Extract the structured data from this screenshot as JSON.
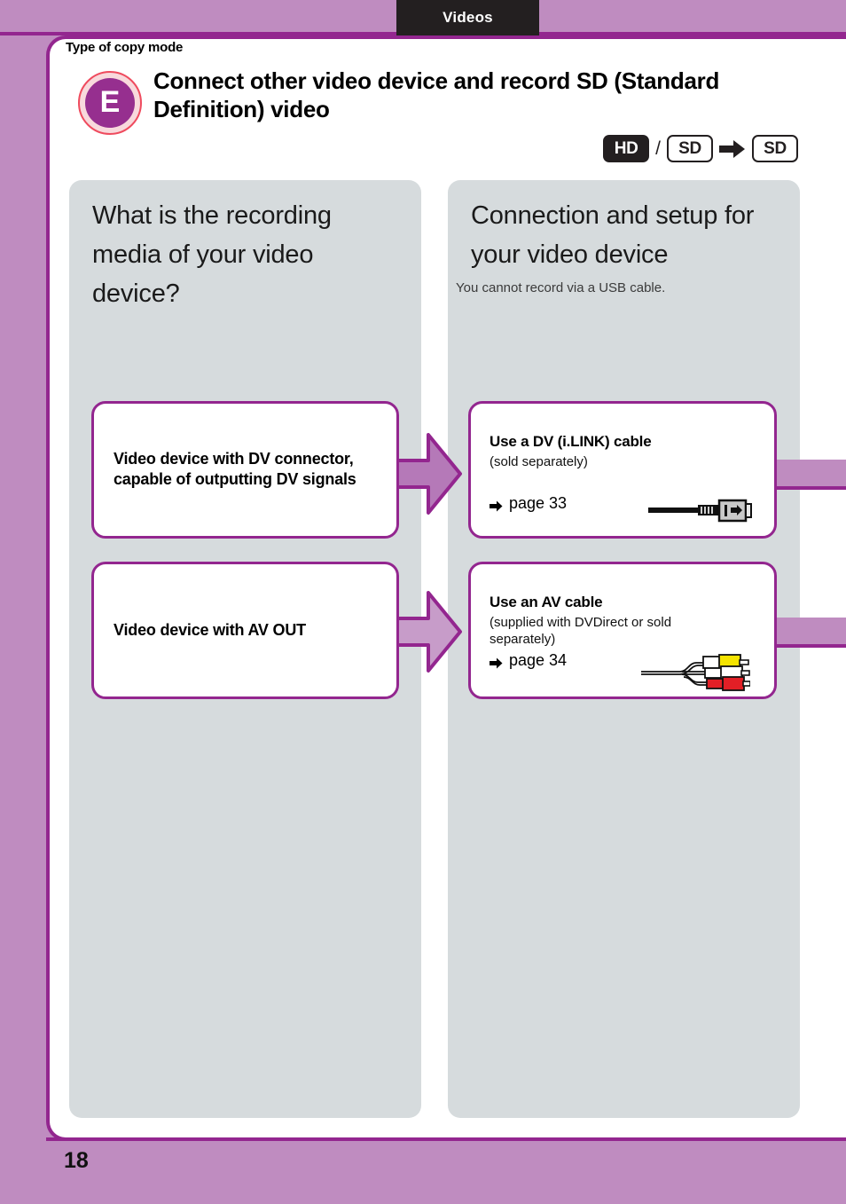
{
  "header": {
    "tab_label": "Videos",
    "kicker": "Type of copy mode",
    "badge_letter": "E",
    "title": "Connect other video device and record SD (Standard Definition) video"
  },
  "format_row": {
    "source_hd": "HD",
    "separator": "/",
    "source_sd": "SD",
    "arrow_icon": "right-arrow-icon",
    "target_sd": "SD"
  },
  "columns": {
    "left": {
      "title": "What is the recording media of your video device?",
      "boxes": [
        {
          "text": "Video device with DV connector, capable of outputting DV signals"
        },
        {
          "text": "Video device with AV OUT"
        }
      ]
    },
    "right": {
      "title": "Connection and setup for your video device",
      "subtitle": "You cannot record via a USB cable.",
      "boxes": [
        {
          "title": "Use a DV (i.LINK) cable",
          "sub": "(sold separately)",
          "page_ref": "page 33",
          "icon": "dv-ilink-cable-icon"
        },
        {
          "title": "Use an AV cable",
          "sub": "(supplied with DVDirect or sold separately)",
          "page_ref": "page 34",
          "icon": "av-rca-cable-icon"
        }
      ]
    }
  },
  "footer": {
    "page_number": "18"
  },
  "colors": {
    "page_background": "#bf8cc0",
    "accent_purple": "#93268f",
    "badge_purple": "#962f8f",
    "panel_grey": "#d6dbdd",
    "tab_black": "#231f20"
  }
}
